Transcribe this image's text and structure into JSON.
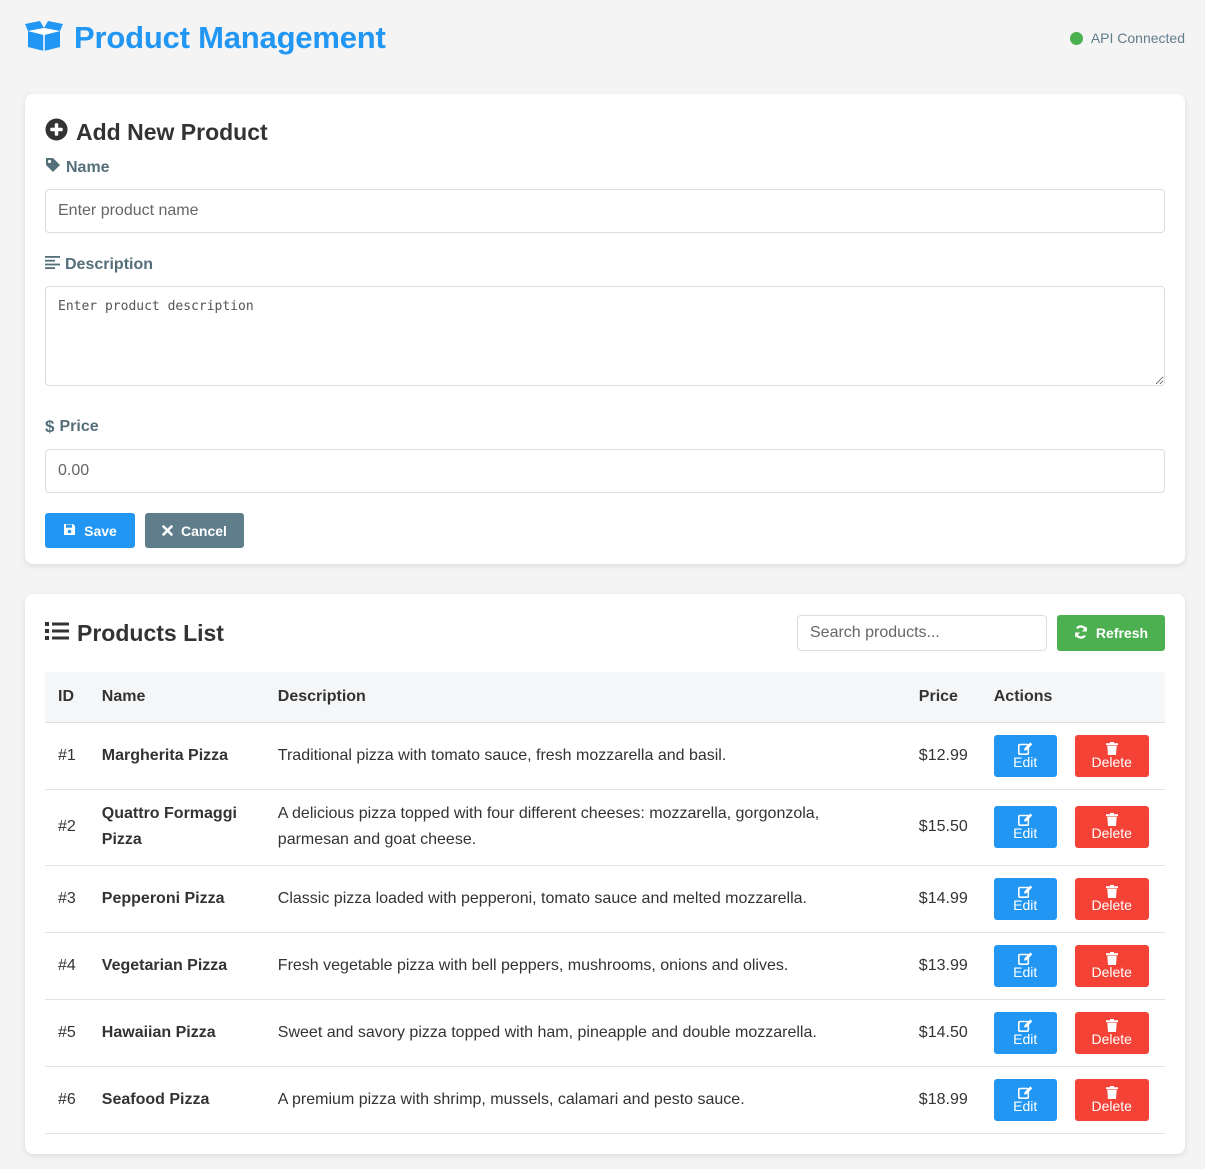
{
  "header": {
    "title": "Product Management",
    "status": "API Connected"
  },
  "form": {
    "title": "Add New Product",
    "name_label": "Name",
    "name_placeholder": "Enter product name",
    "description_label": "Description",
    "description_placeholder": "Enter product description",
    "price_label": "Price",
    "price_placeholder": "0.00",
    "save_label": "Save",
    "cancel_label": "Cancel"
  },
  "list": {
    "title": "Products List",
    "search_placeholder": "Search products...",
    "refresh_label": "Refresh",
    "columns": [
      "ID",
      "Name",
      "Description",
      "Price",
      "Actions"
    ],
    "edit_label": "Edit",
    "delete_label": "Delete",
    "rows": [
      {
        "id": "#1",
        "name": "Margherita Pizza",
        "description": "Traditional pizza with tomato sauce, fresh mozzarella and basil.",
        "price": "$12.99"
      },
      {
        "id": "#2",
        "name": "Quattro Formaggi Pizza",
        "description": "A delicious pizza topped with four different cheeses: mozzarella, gorgonzola, parmesan and goat cheese.",
        "price": "$15.50"
      },
      {
        "id": "#3",
        "name": "Pepperoni Pizza",
        "description": "Classic pizza loaded with pepperoni, tomato sauce and melted mozzarella.",
        "price": "$14.99"
      },
      {
        "id": "#4",
        "name": "Vegetarian Pizza",
        "description": "Fresh vegetable pizza with bell peppers, mushrooms, onions and olives.",
        "price": "$13.99"
      },
      {
        "id": "#5",
        "name": "Hawaiian Pizza",
        "description": "Sweet and savory pizza topped with ham, pineapple and double mozzarella.",
        "price": "$14.50"
      },
      {
        "id": "#6",
        "name": "Seafood Pizza",
        "description": "A premium pizza with shrimp, mussels, calamari and pesto sauce.",
        "price": "$18.99"
      }
    ]
  },
  "icons": {
    "brand": "box-open-icon",
    "status": "status-dot-icon",
    "add": "plus-circle-icon",
    "name": "tag-icon",
    "description": "align-left-icon",
    "price": "dollar-icon",
    "save": "floppy-disk-icon",
    "cancel": "times-icon",
    "list": "list-icon",
    "refresh": "refresh-icon",
    "edit": "edit-icon",
    "delete": "trash-icon"
  },
  "colors": {
    "primary": "#2196f3",
    "success": "#4caf50",
    "danger": "#f44336",
    "secondary": "#607d8b",
    "background": "#f4f4f4"
  }
}
